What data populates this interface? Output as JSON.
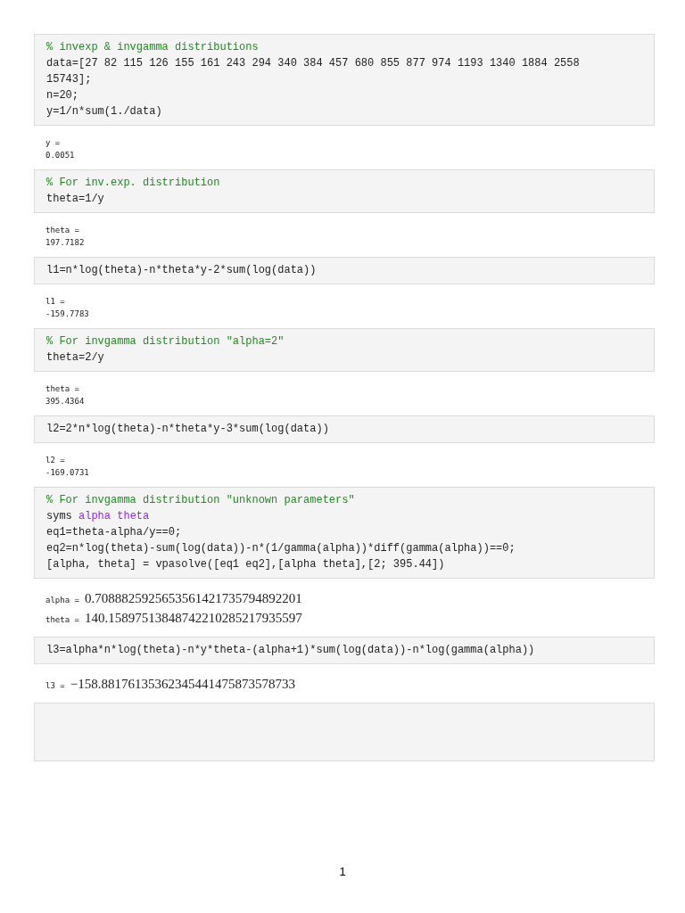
{
  "cells": [
    {
      "kind": "code",
      "lines": [
        [
          {
            "kind": "comment",
            "text": "% invexp & invgamma distributions"
          }
        ],
        [
          {
            "kind": "plain",
            "text": "data=[27 82 115 126 155 161 243 294 340 384 457 680 855 877 974 1193 1340 1884 2558 15743];"
          }
        ],
        [
          {
            "kind": "plain",
            "text": "n=20;"
          }
        ],
        [
          {
            "kind": "plain",
            "text": "y=1/n*sum(1./data)"
          }
        ]
      ]
    },
    {
      "kind": "output",
      "results": [
        {
          "kind": "numeric",
          "name": "y =",
          "value": "0.0051"
        }
      ]
    },
    {
      "kind": "code",
      "lines": [
        [
          {
            "kind": "comment",
            "text": "% For inv.exp. distribution"
          }
        ],
        [
          {
            "kind": "plain",
            "text": "theta=1/y"
          }
        ]
      ]
    },
    {
      "kind": "output",
      "results": [
        {
          "kind": "numeric",
          "name": "theta =",
          "value": "197.7182"
        }
      ]
    },
    {
      "kind": "code",
      "lines": [
        [
          {
            "kind": "plain",
            "text": "l1=n*log(theta)-n*theta*y-2*sum(log(data))"
          }
        ]
      ]
    },
    {
      "kind": "output",
      "results": [
        {
          "kind": "numeric",
          "name": "l1 =",
          "value": "-159.7783"
        }
      ]
    },
    {
      "kind": "code",
      "lines": [
        [
          {
            "kind": "comment",
            "text": "% For invgamma distribution \"alpha=2\""
          }
        ],
        [
          {
            "kind": "plain",
            "text": "theta=2/y"
          }
        ]
      ]
    },
    {
      "kind": "output",
      "results": [
        {
          "kind": "numeric",
          "name": "theta =",
          "value": "395.4364"
        }
      ]
    },
    {
      "kind": "code",
      "lines": [
        [
          {
            "kind": "plain",
            "text": "l2=2*n*log(theta)-n*theta*y-3*sum(log(data))"
          }
        ]
      ]
    },
    {
      "kind": "output",
      "results": [
        {
          "kind": "numeric",
          "name": "l2 =",
          "value": "-169.0731"
        }
      ]
    },
    {
      "kind": "code",
      "lines": [
        [
          {
            "kind": "comment",
            "text": "% For invgamma distribution \"unknown parameters\""
          }
        ],
        [
          {
            "kind": "plain",
            "text": "syms"
          },
          {
            "kind": "symbol",
            "text": "alpha theta"
          }
        ],
        [
          {
            "kind": "plain",
            "text": "eq1=theta-alpha/y==0;"
          }
        ],
        [
          {
            "kind": "plain",
            "text": "eq2=n*log(theta)-sum(log(data))-n*(1/gamma(alpha))*diff(gamma(alpha))==0;"
          }
        ],
        [
          {
            "kind": "plain",
            "text": "[alpha, theta] = vpasolve([eq1 eq2],[alpha theta],[2; 395.44])"
          }
        ]
      ]
    },
    {
      "kind": "output",
      "results": [
        {
          "kind": "symbolic",
          "name": "alpha =",
          "value": "0.7088825925653561421735794892201"
        },
        {
          "kind": "symbolic",
          "name": "theta =",
          "value": "140.15897513848742210285217935597"
        }
      ]
    },
    {
      "kind": "code",
      "lines": [
        [
          {
            "kind": "plain",
            "text": "l3=alpha*n*log(theta)-n*y*theta-(alpha+1)*sum(log(data))-n*log(gamma(alpha))"
          }
        ]
      ]
    },
    {
      "kind": "output",
      "results": [
        {
          "kind": "symbolic",
          "name": "l3 =",
          "value": "−158.88176135362345441475873578733"
        }
      ]
    },
    {
      "kind": "code"
    }
  ],
  "page_number": "1"
}
